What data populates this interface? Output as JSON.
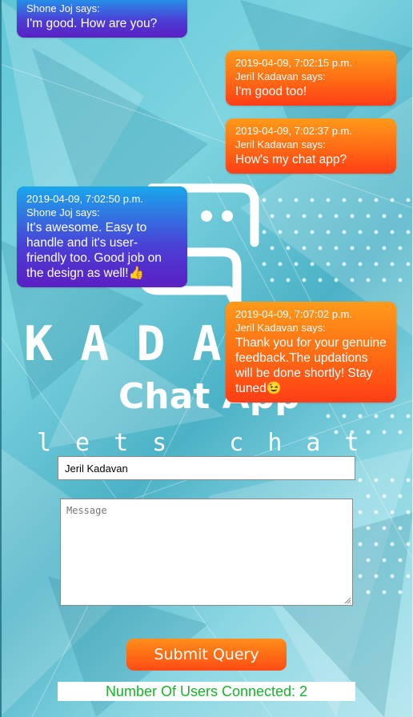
{
  "logo": {
    "word": "KADAVAN",
    "sub": "Chat App",
    "tagline": "lets chat"
  },
  "messages": [
    {
      "side": "left",
      "meta": "Shone Joj says:",
      "text": "I'm good. How are you?"
    },
    {
      "side": "right",
      "timestamp": "2019-04-09, 7:02:15 p.m.",
      "meta": "Jeril Kadavan says:",
      "text": "I'm good too!"
    },
    {
      "side": "right",
      "timestamp": "2019-04-09, 7:02:37 p.m.",
      "meta": "Jeril Kadavan says:",
      "text": "How's my chat app?"
    },
    {
      "side": "left",
      "timestamp": "2019-04-09, 7:02:50 p.m.",
      "meta": "Shone Joj says:",
      "text": "It's awesome. Easy to handle and it's user-friendly too. Good job on the design as well!👍"
    },
    {
      "side": "right",
      "timestamp": "2019-04-09, 7:07:02 p.m.",
      "meta": "Jeril Kadavan says:",
      "text": "Thank you for your genuine feedback.The updations will be done shortly! Stay tuned😉"
    }
  ],
  "form": {
    "name_value": "Jeril Kadavan",
    "message_placeholder": "Message",
    "submit_label": "Submit Query"
  },
  "status": {
    "users_connected": "Number Of Users Connected: 2"
  },
  "colors": {
    "left_bubble": "#4b3fd6",
    "right_bubble": "#ff6a14",
    "button": "#ff6a14",
    "users_text": "#16b42a"
  }
}
